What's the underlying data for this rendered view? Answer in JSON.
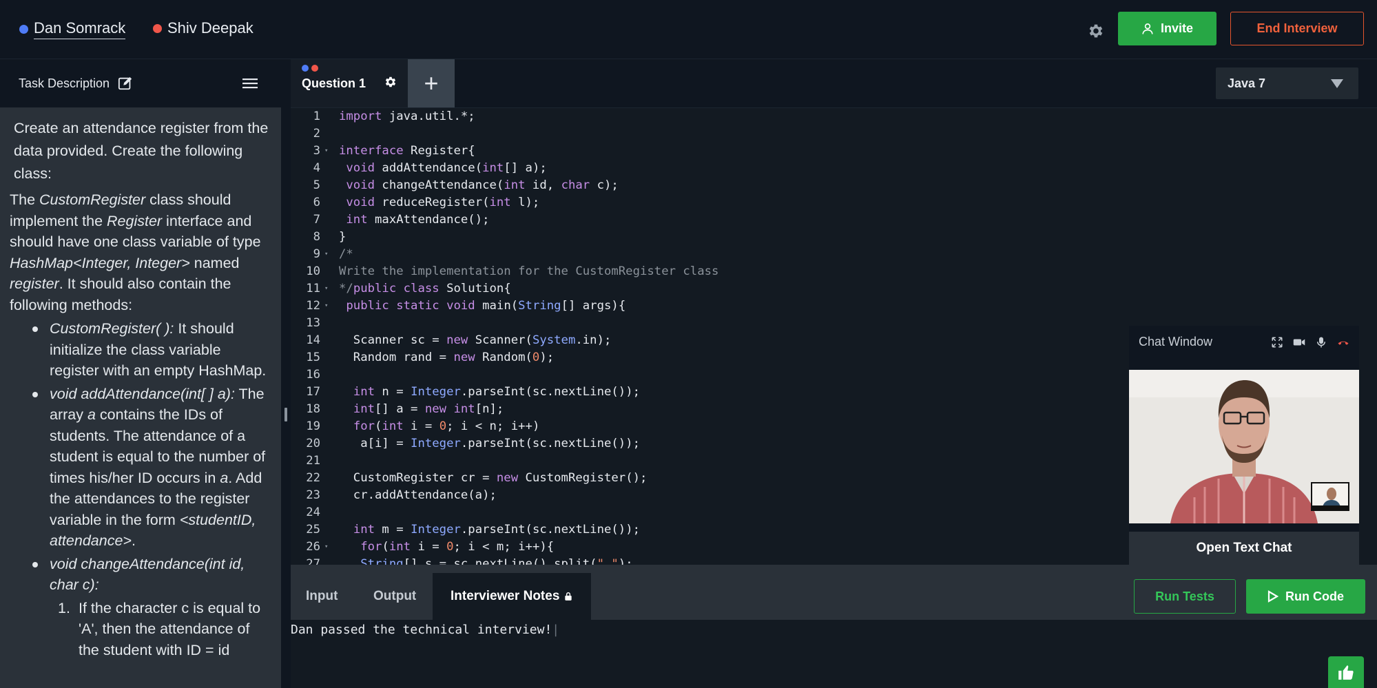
{
  "participants": [
    {
      "name": "Dan Somrack",
      "color": "#4f7cf7"
    },
    {
      "name": "Shiv Deepak",
      "color": "#f0564a"
    }
  ],
  "header": {
    "invite_label": "Invite",
    "end_label": "End Interview"
  },
  "task": {
    "title": "Task Description",
    "intro": "Create an attendance register from the data provided. Create the following class:",
    "p2_a": "The ",
    "p2_class": "CustomRegister",
    "p2_b": " class should implement the ",
    "p2_iface": "Register",
    "p2_c": " interface and should have one class variable of type ",
    "p2_type": "HashMap<Integer, Integer>",
    "p2_d": " named ",
    "p2_var": "register",
    "p2_e": ". It should also contain the following methods:",
    "b1_sig": "CustomRegister( ):",
    "b1_text": " It should initialize the class variable register with an empty HashMap.",
    "b2_sig": "void addAttendance(int[ ] a):",
    "b2_a": " The array ",
    "b2_var": "a",
    "b2_b": " contains the IDs of students. The attendance of a student is equal to the number of times his/her ID occurs in ",
    "b2_var2": "a",
    "b2_c": ". Add the attendances to the register variable in the form ",
    "b2_form": "<studentID, attendance>",
    "b2_d": ".",
    "b3_sig": "void changeAttendance(int id, char c):",
    "o1_num": "1.",
    "o1_text": "If the character c is equal to 'A', then the attendance of the student with ID = id"
  },
  "editor": {
    "tab_label": "Question 1",
    "add_tab": "+",
    "language": "Java 7"
  },
  "chat": {
    "title": "Chat Window",
    "open_text_chat": "Open Text Chat"
  },
  "bottom": {
    "tab_input": "Input",
    "tab_output": "Output",
    "tab_notes": "Interviewer Notes",
    "run_tests": "Run Tests",
    "run_code": "Run Code",
    "notes_text": "Dan passed the technical interview!"
  },
  "colors": {
    "accent_green": "#27a745",
    "end_red": "#e5552d"
  }
}
